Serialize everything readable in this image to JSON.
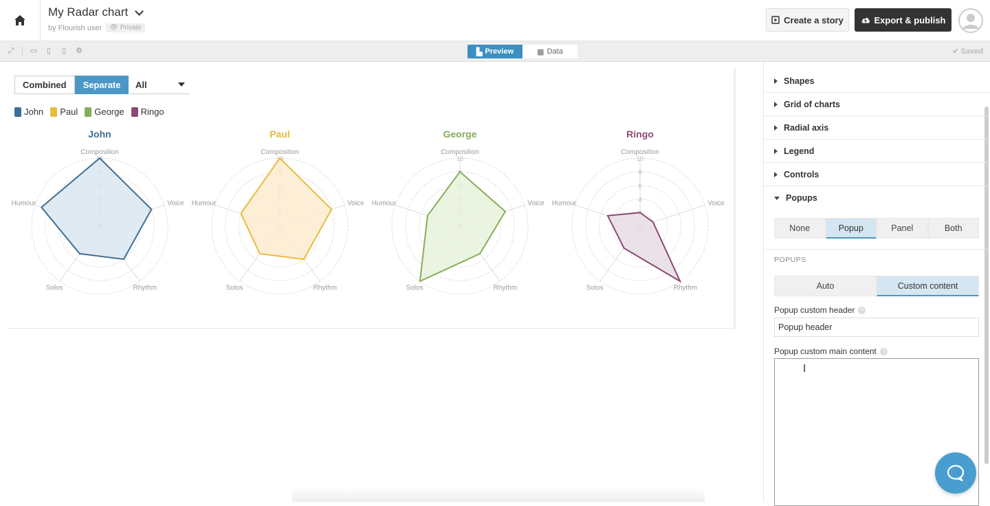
{
  "header": {
    "title": "My Radar chart",
    "byline": "by Flourish user",
    "privacy": "Private",
    "create_story_label": "Create a story",
    "export_label": "Export & publish"
  },
  "toolbar": {
    "preview_label": "Preview",
    "data_label": "Data",
    "saved_label": "Saved"
  },
  "controls": {
    "mode_combined": "Combined",
    "mode_separate": "Separate",
    "filter_value": "All"
  },
  "legend": [
    {
      "name": "John",
      "color": "#3f6e94"
    },
    {
      "name": "Paul",
      "color": "#e8bb3c"
    },
    {
      "name": "George",
      "color": "#86ad5a"
    },
    {
      "name": "Ringo",
      "color": "#8a4a73"
    }
  ],
  "chart_data": {
    "type": "radar",
    "axes": [
      "Composition",
      "Voice",
      "Rhythm",
      "Solos",
      "Humour"
    ],
    "radial_ticks": [
      "0",
      "2",
      "4",
      "6",
      "8",
      "10"
    ],
    "rmax": 10,
    "series": [
      {
        "name": "John",
        "color": "#3f6e94",
        "fill": "#dbe6f0",
        "values": [
          10,
          8,
          6,
          5,
          9
        ]
      },
      {
        "name": "Paul",
        "color": "#e8bb3c",
        "fill": "#fdeccf",
        "values": [
          10,
          8,
          6,
          5,
          6
        ]
      },
      {
        "name": "George",
        "color": "#86ad5a",
        "fill": "#e7f2da",
        "values": [
          8,
          7,
          5,
          10,
          5
        ]
      },
      {
        "name": "Ringo",
        "color": "#8a4a73",
        "fill": "#e8dde3",
        "values": [
          2,
          2,
          10,
          4,
          5
        ]
      }
    ]
  },
  "panel": {
    "sections": [
      "Shapes",
      "Grid of charts",
      "Radial axis",
      "Legend",
      "Controls"
    ],
    "open_section": "Popups",
    "popup_modes": [
      "None",
      "Popup",
      "Panel",
      "Both"
    ],
    "popup_mode_selected": "Popup",
    "popups_sublabel": "POPUPS",
    "content_modes": [
      "Auto",
      "Custom content"
    ],
    "content_mode_selected": "Custom content",
    "custom_header_label": "Popup custom header",
    "custom_header_value": "Popup header",
    "custom_main_label": "Popup custom main content",
    "help_glyph": "?"
  }
}
